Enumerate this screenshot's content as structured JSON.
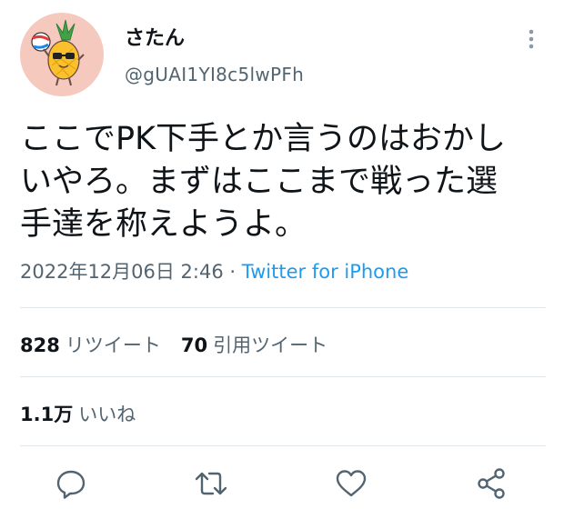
{
  "user": {
    "display_name": "さたん",
    "handle": "@gUAI1YI8c5lwPFh",
    "avatar_icon": "pineapple-mascot-icon"
  },
  "tweet": {
    "text": "ここでPK下手とか言うのはおかし\nいやろ。まずはここまで戦った選\n手達を称えようよ。",
    "timestamp": "2022年12月06日 2:46",
    "separator": " · ",
    "source": "Twitter for iPhone"
  },
  "stats": {
    "retweets_count": "828",
    "retweets_label": "リツイート",
    "quotes_count": "70",
    "quotes_label": "引用ツイート",
    "likes_count": "1.1万",
    "likes_label": "いいね"
  },
  "actions": {
    "reply_icon": "reply-icon",
    "retweet_icon": "retweet-icon",
    "like_icon": "heart-icon",
    "share_icon": "share-icon"
  },
  "colors": {
    "text_primary": "#0f1419",
    "text_secondary": "#536471",
    "link": "#1d9bf0",
    "divider": "#e1e6ea",
    "avatar_bg": "#f6c9bf"
  }
}
